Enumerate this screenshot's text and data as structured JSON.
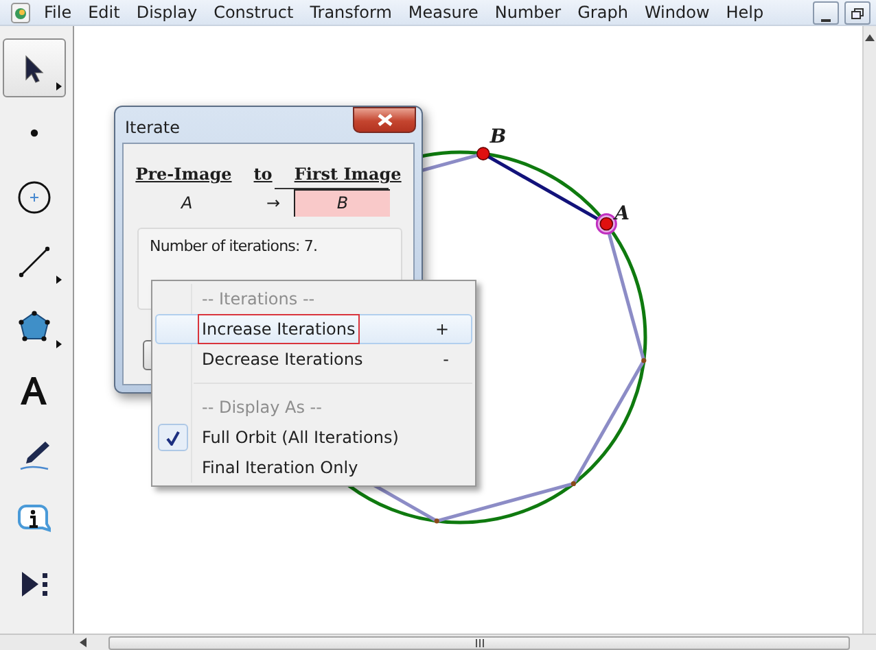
{
  "menu_bar": {
    "items": [
      "File",
      "Edit",
      "Display",
      "Construct",
      "Transform",
      "Measure",
      "Number",
      "Graph",
      "Window",
      "Help"
    ]
  },
  "toolbox": [
    {
      "kind": "arrow",
      "selected": true,
      "has_submenu": true
    },
    {
      "kind": "point",
      "selected": false,
      "has_submenu": false
    },
    {
      "kind": "compass",
      "selected": false,
      "has_submenu": false
    },
    {
      "kind": "straightedge",
      "selected": false,
      "has_submenu": true
    },
    {
      "kind": "polygon",
      "selected": false,
      "has_submenu": true
    },
    {
      "kind": "text",
      "selected": false,
      "has_submenu": false
    },
    {
      "kind": "marker",
      "selected": false,
      "has_submenu": false
    },
    {
      "kind": "information",
      "selected": false,
      "has_submenu": false
    },
    {
      "kind": "custom",
      "selected": false,
      "has_submenu": false
    }
  ],
  "sketch": {
    "points": [
      {
        "label": "B",
        "selected": false
      },
      {
        "label": "A",
        "selected": true
      }
    ]
  },
  "dialog": {
    "title": "Iterate",
    "columns": [
      "Pre-Image",
      "to",
      "First Image"
    ],
    "mapping": {
      "pre_image": "A",
      "arrow": "→",
      "first_image": "B",
      "first_image_selected": true
    },
    "info": "Number of iterations: 7."
  },
  "context_menu": {
    "items": [
      {
        "kind": "header",
        "label": "-- Iterations --"
      },
      {
        "kind": "item",
        "label": "Increase Iterations",
        "shortcut": "+",
        "highlighted": true,
        "outlined": true,
        "checked": false
      },
      {
        "kind": "item",
        "label": "Decrease Iterations",
        "shortcut": "-",
        "highlighted": false,
        "outlined": false,
        "checked": false
      },
      {
        "kind": "separator"
      },
      {
        "kind": "header",
        "label": "-- Display As --"
      },
      {
        "kind": "item",
        "label": "Full Orbit (All Iterations)",
        "highlighted": false,
        "outlined": false,
        "checked": true
      },
      {
        "kind": "item",
        "label": "Final Iteration Only",
        "highlighted": false,
        "outlined": false,
        "checked": false
      }
    ]
  }
}
